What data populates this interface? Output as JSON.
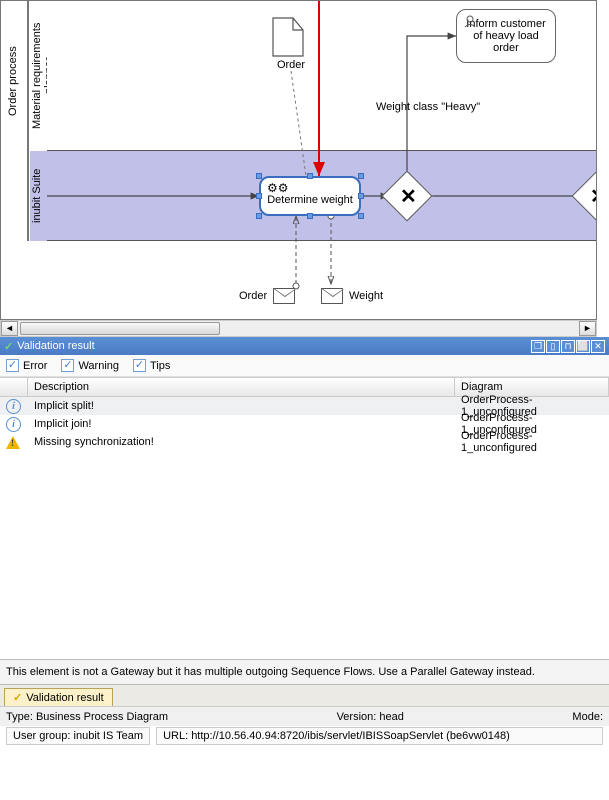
{
  "diagram": {
    "pool_label": "Order process",
    "lane1_label": "Material requirements planner",
    "lane2_label": "inubit Suite",
    "data_object": "Order",
    "task_inform": "Inform customer of heavy load order",
    "task_determine": "Determine weight",
    "edge_label": "Weight class \"Heavy\"",
    "msg_left": "Order",
    "msg_right": "Weight"
  },
  "panel": {
    "title": "Validation result",
    "filter_error": "Error",
    "filter_warning": "Warning",
    "filter_tips": "Tips",
    "col_description": "Description",
    "col_diagram": "Diagram",
    "rows": [
      {
        "icon": "info",
        "desc": "Implicit split!",
        "diagram": "OrderProcess-1_unconfigured",
        "selected": true
      },
      {
        "icon": "info",
        "desc": "Implicit join!",
        "diagram": "OrderProcess-1_unconfigured",
        "selected": false
      },
      {
        "icon": "warn",
        "desc": "Missing synchronization!",
        "diagram": "OrderProcess-1_unconfigured",
        "selected": false
      }
    ],
    "detail": "This element is not a Gateway but it has multiple outgoing Sequence Flows. Use a Parallel Gateway instead.",
    "tab_label": "Validation result"
  },
  "status": {
    "type_label": "Type:",
    "type_value": "Business Process Diagram",
    "version_label": "Version:",
    "version_value": "head",
    "mode_label": "Mode:"
  },
  "footer": {
    "usergroup_label": "User group:",
    "usergroup_value": "inubit IS Team",
    "url_label": "URL:",
    "url_value": "http://10.56.40.94:8720/ibis/servlet/IBISSoapServlet (be6vw0148)"
  }
}
